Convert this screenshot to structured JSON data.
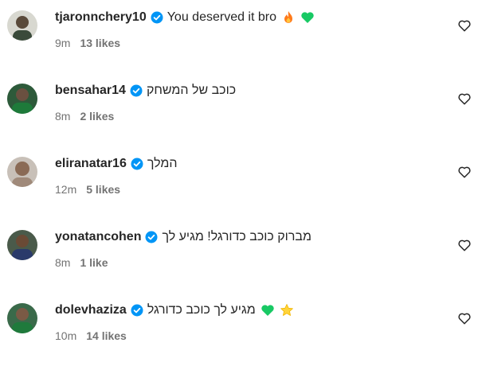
{
  "comments": [
    {
      "username": "tjaronnchery10",
      "text": "You deserved it bro",
      "time": "9m",
      "likes": "13 likes",
      "emojis": [
        "fire-emoji",
        "green-heart-emoji"
      ],
      "avatar_color": "#3a4a3a"
    },
    {
      "username": "bensahar14",
      "text": "כוכב של המשחק",
      "time": "8m",
      "likes": "2 likes",
      "emojis": [],
      "avatar_color": "#1e7a3a"
    },
    {
      "username": "eliranatar16",
      "text": "המלך",
      "time": "12m",
      "likes": "5 likes",
      "emojis": [],
      "avatar_color": "#a08a7a"
    },
    {
      "username": "yonatancohen",
      "text": "מברוק כוכב כדורגל! מגיע לך",
      "time": "8m",
      "likes": "1 like",
      "emojis": [],
      "avatar_color": "#2a3a6a"
    },
    {
      "username": "dolevhaziza",
      "text": "מגיע לך כוכב כדורגל",
      "time": "10m",
      "likes": "14 likes",
      "emojis": [
        "green-heart-emoji",
        "star-emoji"
      ],
      "avatar_color": "#1f7a3c"
    }
  ],
  "colors": {
    "verified": "#0095f6",
    "secondary_text": "#737373",
    "green_heart": "#18c964",
    "fire": "#ff7a1a",
    "star": "#ffd43b"
  }
}
